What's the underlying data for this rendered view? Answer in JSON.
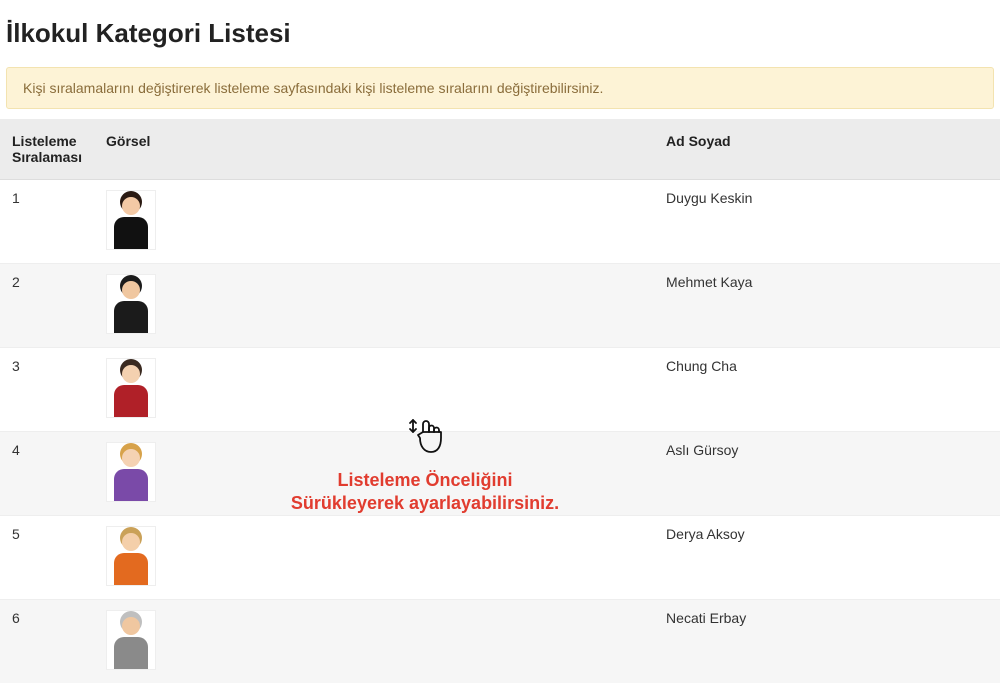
{
  "page_title": "İlkokul Kategori Listesi",
  "alert_text": "Kişi sıralamalarını değiştirerek listeleme sayfasındaki kişi listeleme sıralarını değiştirebilirsiniz.",
  "table": {
    "headers": {
      "order": "Listeleme Sıralaması",
      "image": "Görsel",
      "name": "Ad Soyad"
    },
    "rows": [
      {
        "order": "1",
        "name": "Duygu Keskin",
        "avatar": {
          "skin": "#f3c9a5",
          "hair": "#2a1a12",
          "clothes": "#111111"
        }
      },
      {
        "order": "2",
        "name": "Mehmet Kaya",
        "avatar": {
          "skin": "#f0c7a0",
          "hair": "#1b1b1b",
          "clothes": "#1b1b1b"
        }
      },
      {
        "order": "3",
        "name": "Chung Cha",
        "avatar": {
          "skin": "#f4d1b0",
          "hair": "#3a2a20",
          "clothes": "#b02028"
        }
      },
      {
        "order": "4",
        "name": "Aslı Gürsoy",
        "avatar": {
          "skin": "#f5d2b3",
          "hair": "#d7a24a",
          "clothes": "#7a4aa8"
        }
      },
      {
        "order": "5",
        "name": "Derya Aksoy",
        "avatar": {
          "skin": "#f4cfaa",
          "hair": "#caa158",
          "clothes": "#e36a1f"
        }
      },
      {
        "order": "6",
        "name": "Necati Erbay",
        "avatar": {
          "skin": "#f0c7a0",
          "hair": "#bfbfbf",
          "clothes": "#8a8a8a"
        }
      }
    ]
  },
  "overlay": {
    "text": "Listeleme Önceliğini\nSürükleyerek ayarlayabilirsiniz.",
    "icon": "swipe-vertical-icon"
  }
}
